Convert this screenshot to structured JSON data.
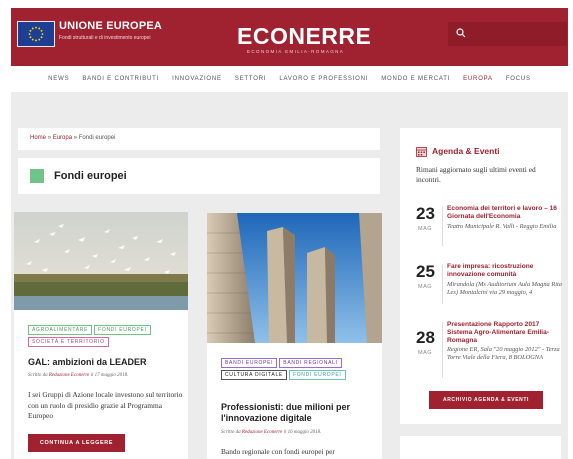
{
  "header": {
    "eu_title": "UNIONE EUROPEA",
    "eu_subtitle": "Fondi strutturali e di investimento europei",
    "logo": "ECONERRE",
    "logo_sub": "ECONOMIA EMILIA-ROMAGNA"
  },
  "nav": {
    "items": [
      "NEWS",
      "BANDI E CONTRIBUTI",
      "INNOVAZIONE",
      "SETTORI",
      "LAVORO E PROFESSIONI",
      "MONDO E MERCATI",
      "EUROPA",
      "FOCUS"
    ],
    "active": "EUROPA"
  },
  "breadcrumb": {
    "home": "Home",
    "sep": "»",
    "section": "Europa",
    "current": "Fondi europei"
  },
  "page_title": "Fondi europei",
  "articles": [
    {
      "tags": [
        "AGROALIMENTARE",
        "FONDI EUROPEI",
        "SOCIETÀ E TERRITORIO"
      ],
      "title": "GAL: ambizioni da LEADER",
      "meta_prefix": "Scritto da",
      "author": "Redazione Econerre",
      "date": "il 17 maggio 2018.",
      "excerpt": "I sei Gruppi di Azione locale investono sul territorio con un ruolo di presidio grazie al Programma Europeo",
      "button": "CONTINUA A LEGGERE"
    },
    {
      "tags": [
        "BANDI EUROPEI",
        "BANDI REGIONALI",
        "CULTURA DIGITALE",
        "FONDI EUROPEI"
      ],
      "title": "Professionisti: due milioni per l'innovazione digitale",
      "meta_prefix": "Scritto da",
      "author": "Redazione Econerre",
      "date": "il 16 maggio 2018.",
      "excerpt": "Bando regionale con fondi europei per"
    }
  ],
  "agenda": {
    "title": "Agenda & Eventi",
    "intro": "Rimani aggiornato sugli ultimi eventi ed incontri.",
    "events": [
      {
        "day": "23",
        "month": "MAG",
        "title": "Economia dei territori e lavoro – 16 Giornata dell'Economia",
        "place": "Teatro Municipale R. Valli - Reggio Emilia"
      },
      {
        "day": "25",
        "month": "MAG",
        "title": "Fare impresa: ricostruzione innovazione comunità",
        "place": "Mirandola (Ms Auditorium Aula Magna Rita Les) Montalcini via 29 maggio, 4"
      },
      {
        "day": "28",
        "month": "MAG",
        "title": "Presentazione Rapporto 2017 Sistema Agro-Alimentare Emilia-Romagna",
        "place": "Regione ER, Sala \"20 maggio 2012\" - Terza Torre Viale della Fiera, 8 BOLOGNA"
      }
    ],
    "button": "ARCHIVIO AGENDA & EVENTI"
  },
  "colors": {
    "brand": "#a02230",
    "accent_green": "#70c489",
    "page_bg": "#ececec"
  }
}
